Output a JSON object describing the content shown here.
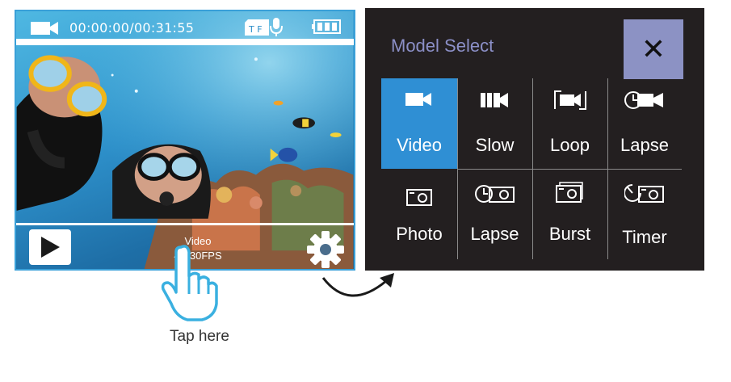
{
  "camera": {
    "timer": "00:00:00/00:31:55",
    "mode_name": "Video",
    "mode_res": "4K 30FPS"
  },
  "hint": {
    "tap_label": "Tap here"
  },
  "mode_select": {
    "title": "Model Select",
    "close_glyph": "✕",
    "modes": [
      {
        "label": "Video",
        "icon": "video-icon",
        "selected": true
      },
      {
        "label": "Slow",
        "icon": "slow-motion-icon",
        "selected": false
      },
      {
        "label": "Loop",
        "icon": "loop-icon",
        "selected": false
      },
      {
        "label": "Lapse",
        "icon": "video-lapse-icon",
        "selected": false
      },
      {
        "label": "Photo",
        "icon": "photo-icon",
        "selected": false
      },
      {
        "label": "Lapse",
        "icon": "photo-lapse-icon",
        "selected": false
      },
      {
        "label": "Burst",
        "icon": "burst-icon",
        "selected": false
      },
      {
        "label": "Timer",
        "icon": "self-timer-icon",
        "selected": false
      }
    ],
    "accent_color": "#2f8fd4",
    "close_color": "#8c92c4",
    "title_color": "#8c90c8"
  }
}
